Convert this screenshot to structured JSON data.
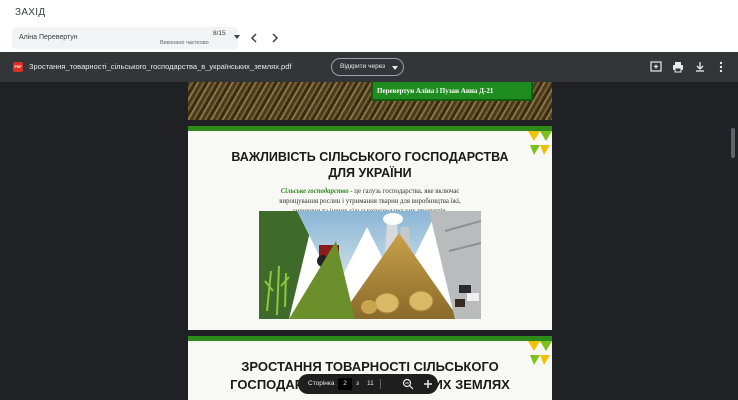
{
  "header": {
    "title": "ЗАХІД"
  },
  "student_nav": {
    "name": "Аліна Перевертун",
    "count": "8/15",
    "status": "Виконано частково"
  },
  "pdf": {
    "filename": "Зростання_товарності_сільського_господарства_в_українських_землях.pdf",
    "open_with": "Відкрити через",
    "badge": "PDF"
  },
  "page1": {
    "authors": "Перевертун Аліна і Пузан Анна Д-21"
  },
  "page2": {
    "heading_line1": "ВАЖЛИВІСТЬ СІЛЬСЬКОГО ГОСПОДАРСТВА",
    "heading_line2": "ДЛЯ УКРАЇНИ",
    "term": "Сільське господарство",
    "body_line1_rest": " - це галузь господарства, яке включає",
    "body_line2": "вирощування рослин і утримання тварин для виробництва їжі,",
    "body_line3": "сировини та інших сільськогосподарських продуктів."
  },
  "page3": {
    "heading_line1": "ЗРОСТАННЯ ТОВАРНОСТІ СІЛЬСЬКОГО",
    "heading_line2a": "ГОСПОДАР",
    "heading_line2b": "ИХ ЗЕМЛЯХ"
  },
  "page_nav": {
    "label": "Сторінка",
    "current": "2",
    "of": "з",
    "total": "11"
  },
  "colors": {
    "accent_green": "#2e8b1a",
    "viewer_bg": "#202124",
    "toolbar_bg": "#323639"
  }
}
